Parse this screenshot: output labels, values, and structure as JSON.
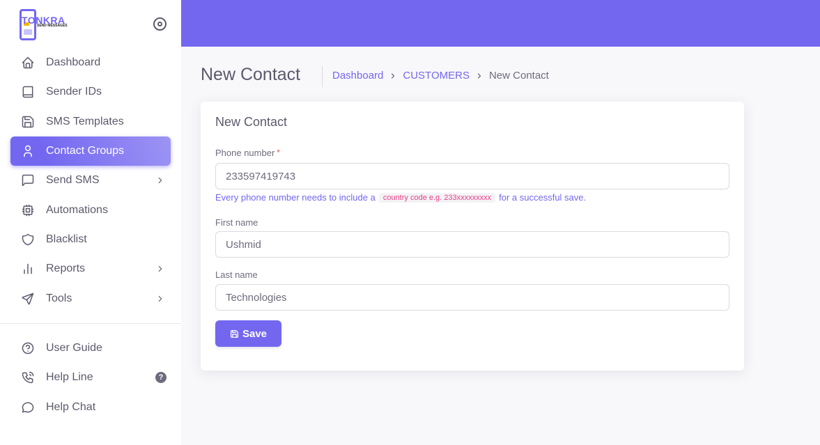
{
  "brand": {
    "name": "TONKRA",
    "tagline": "SEND MESSAGES"
  },
  "sidebar": {
    "items": [
      {
        "label": "Dashboard",
        "icon": "home-icon"
      },
      {
        "label": "Sender IDs",
        "icon": "book-icon"
      },
      {
        "label": "SMS Templates",
        "icon": "save-icon"
      },
      {
        "label": "Contact Groups",
        "icon": "user-icon",
        "active": true
      },
      {
        "label": "Send SMS",
        "icon": "message-icon",
        "has_submenu": true
      },
      {
        "label": "Automations",
        "icon": "cpu-icon"
      },
      {
        "label": "Blacklist",
        "icon": "shield-icon"
      },
      {
        "label": "Reports",
        "icon": "bar-chart-icon",
        "has_submenu": true
      },
      {
        "label": "Tools",
        "icon": "send-icon",
        "has_submenu": true
      }
    ],
    "bottom_items": [
      {
        "label": "User Guide",
        "icon": "help-circle-icon"
      },
      {
        "label": "Help Line",
        "icon": "phone-call-icon",
        "badge": "?"
      },
      {
        "label": "Help Chat",
        "icon": "chat-icon"
      }
    ]
  },
  "colors": {
    "primary": "#7367f0",
    "background": "#f8f7fa",
    "text": "#5d596c",
    "required": "#ea5455",
    "code": "#e83e8c"
  },
  "header": {
    "title": "New Contact",
    "breadcrumb": [
      "Dashboard",
      "CUSTOMERS",
      "New Contact"
    ]
  },
  "form": {
    "title": "New Contact",
    "phone": {
      "label": "Phone number",
      "required_mark": "*",
      "value": "233597419743"
    },
    "helper": {
      "before": "Every phone number needs to include a",
      "code": "country code e.g. 233xxxxxxxxx",
      "after": "for a successful save."
    },
    "first_name": {
      "label": "First name",
      "value": "Ushmid"
    },
    "last_name": {
      "label": "Last name",
      "value": "Technologies"
    },
    "save_label": "Save"
  }
}
